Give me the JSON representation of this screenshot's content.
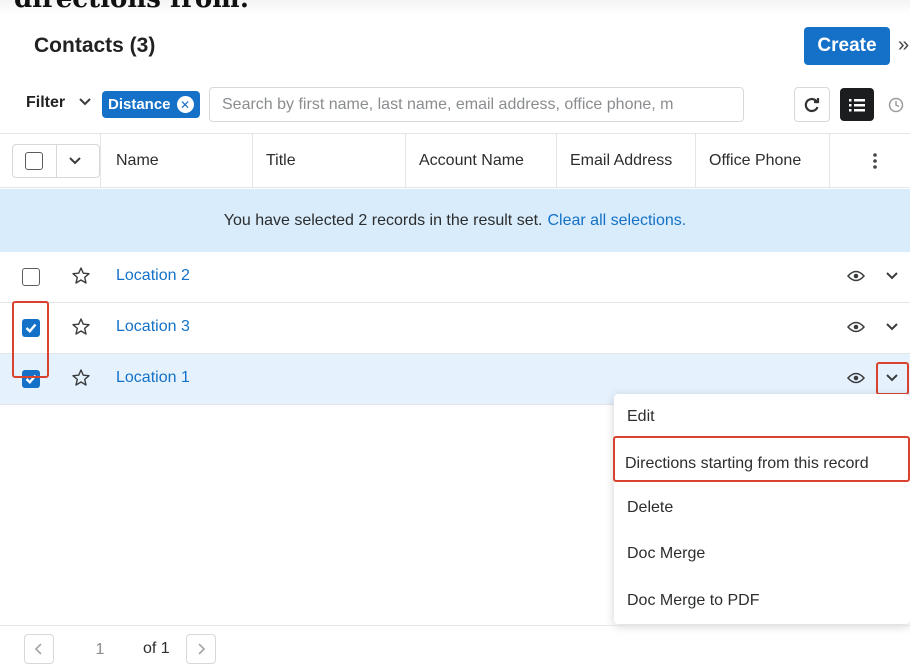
{
  "caption": "directions from:",
  "header": {
    "title": "Contacts (3)",
    "create_label": "Create"
  },
  "filter": {
    "label": "Filter",
    "pill_label": "Distance",
    "search_placeholder": "Search by first name, last name, email address, office phone, m"
  },
  "columns": [
    "Name",
    "Title",
    "Account Name",
    "Email Address",
    "Office Phone"
  ],
  "banner": {
    "text": "You have selected 2 records in the result set.",
    "link": "Clear all selections."
  },
  "rows": [
    {
      "name": "Location 2",
      "checked": false
    },
    {
      "name": "Location 3",
      "checked": true
    },
    {
      "name": "Location 1",
      "checked": true
    }
  ],
  "menu": [
    "Edit",
    "Directions starting from this record",
    "Delete",
    "Doc Merge",
    "Doc Merge to PDF"
  ],
  "pagination": {
    "page": "1",
    "of": "of 1"
  },
  "colors": {
    "accent": "#1471c7",
    "highlight": "#d8432f",
    "banner_bg": "#d9ecfb"
  }
}
